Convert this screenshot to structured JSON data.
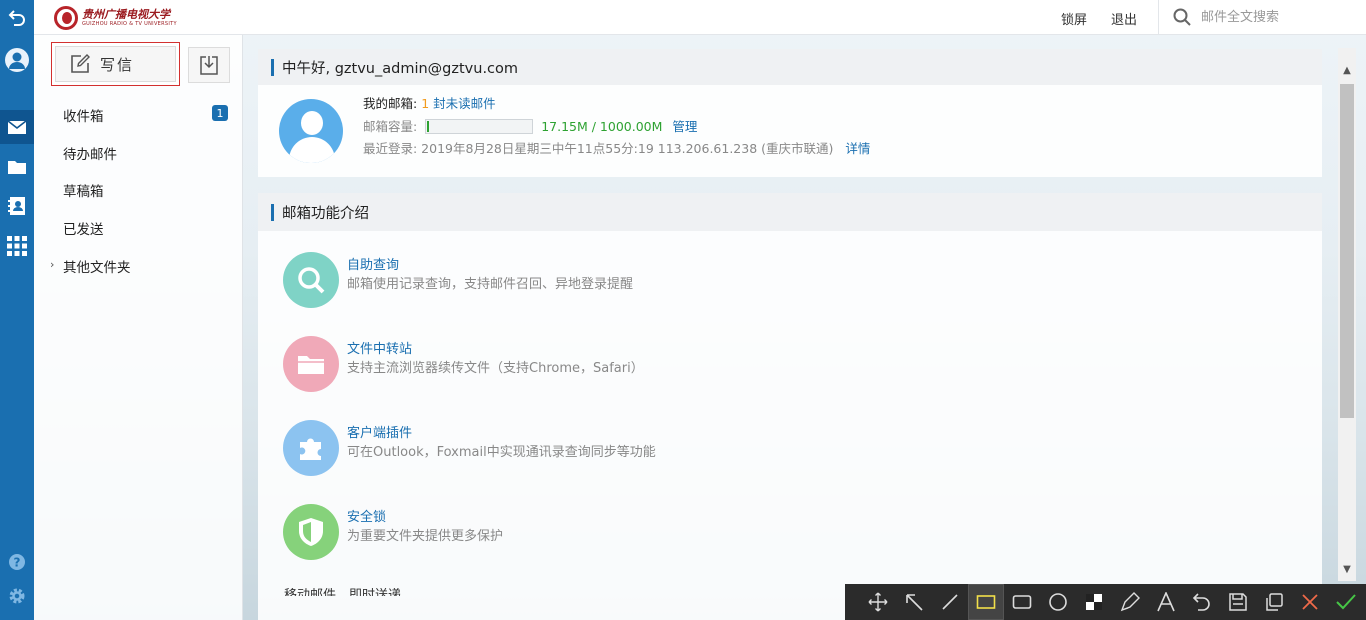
{
  "header": {
    "logo_cn": "贵州广播电视大学",
    "logo_en": "GUIZHOU RADIO & TV UNIVERSITY",
    "lock_label": "锁屏",
    "logout_label": "退出",
    "search_placeholder": "邮件全文搜索"
  },
  "sidebar": {
    "compose_label": "写信",
    "folders": [
      {
        "label": "收件箱",
        "badge": "1"
      },
      {
        "label": "待办邮件"
      },
      {
        "label": "草稿箱"
      },
      {
        "label": "已发送"
      },
      {
        "label": "其他文件夹"
      }
    ]
  },
  "welcome": {
    "greeting": "中午好, gztvu_admin@gztvu.com",
    "mailbox_label": "我的邮箱:",
    "unread_count": "1",
    "unread_label": "封未读邮件",
    "capacity_label": "邮箱容量:",
    "capacity_value": "17.15M / 1000.00M",
    "capacity_fraction": 0.017,
    "manage_label": "管理",
    "last_login": "最近登录: 2019年8月28日星期三中午11点55分:19   113.206.61.238 (重庆市联通)",
    "details_label": "详情"
  },
  "features": {
    "title": "邮箱功能介绍",
    "items": [
      {
        "title": "自助查询",
        "desc": "邮箱使用记录查询，支持邮件召回、异地登录提醒",
        "color": "#7fd3c6",
        "icon": "search-icon"
      },
      {
        "title": "文件中转站",
        "desc": "支持主流浏览器续传文件（支持Chrome，Safari）",
        "color": "#f0a9b8",
        "icon": "folder-icon"
      },
      {
        "title": "客户端插件",
        "desc": "可在Outlook，Foxmail中实现通讯录查询同步等功能",
        "color": "#8cc3f0",
        "icon": "puzzle-icon"
      },
      {
        "title": "安全锁",
        "desc": "为重要文件夹提供更多保护",
        "color": "#86d27b",
        "icon": "shield-icon"
      }
    ],
    "cut_text": "移动邮件，即时送递"
  },
  "colors": {
    "accent": "#1a6fb0",
    "compose_border": "#d3302f"
  }
}
